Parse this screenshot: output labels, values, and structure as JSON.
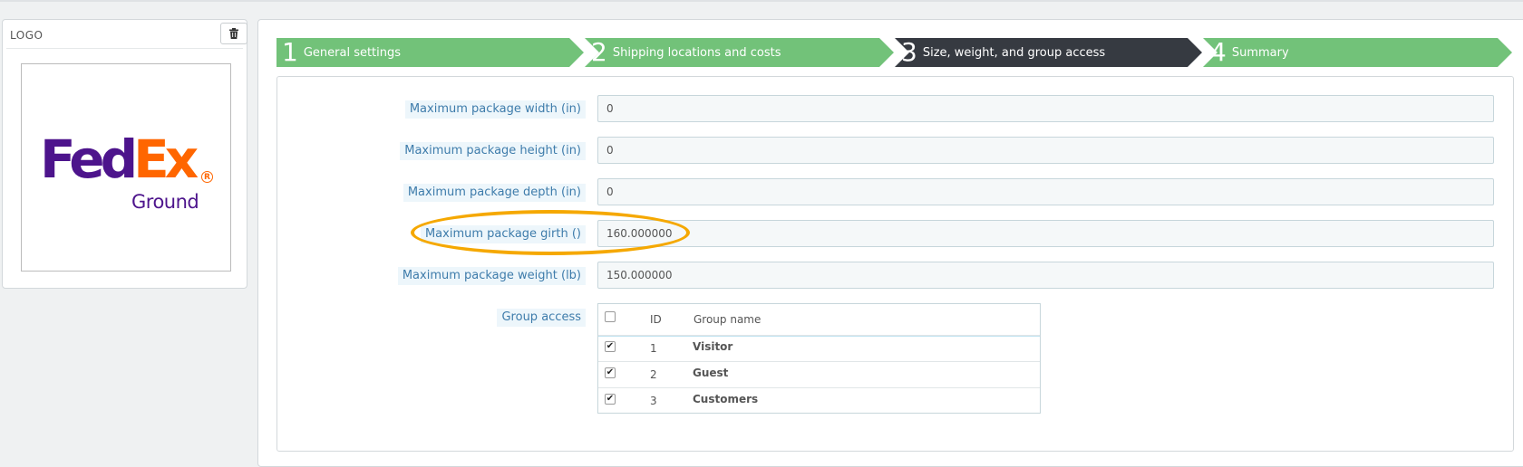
{
  "logo_panel": {
    "title": "LOGO",
    "brand_primary": "#4d148c",
    "brand_accent": "#ff6600",
    "logo_text": {
      "fed": "Fed",
      "ex": "Ex",
      "sub": "Ground",
      "reg": "R"
    }
  },
  "steps": [
    {
      "number": "1",
      "label": "General settings",
      "state": "done",
      "color": "#72c279"
    },
    {
      "number": "2",
      "label": "Shipping locations and costs",
      "state": "done",
      "color": "#72c279"
    },
    {
      "number": "3",
      "label": "Size, weight, and group access",
      "state": "current",
      "color": "#363a41"
    },
    {
      "number": "4",
      "label": "Summary",
      "state": "todo",
      "color": "#72c279"
    }
  ],
  "form": {
    "max_width": {
      "label": "Maximum package width (in)",
      "value": "0"
    },
    "max_height": {
      "label": "Maximum package height (in)",
      "value": "0"
    },
    "max_depth": {
      "label": "Maximum package depth (in)",
      "value": "0"
    },
    "max_girth": {
      "label": "Maximum package girth ()",
      "value": "160.000000"
    },
    "max_weight": {
      "label": "Maximum package weight (lb)",
      "value": "150.000000"
    },
    "group_access": {
      "label": "Group access",
      "columns": {
        "id": "ID",
        "name": "Group name"
      },
      "rows": [
        {
          "id": "1",
          "name": "Visitor",
          "checked": true
        },
        {
          "id": "2",
          "name": "Guest",
          "checked": true
        },
        {
          "id": "3",
          "name": "Customers",
          "checked": true
        }
      ]
    }
  },
  "highlight_color": "#f5a800"
}
